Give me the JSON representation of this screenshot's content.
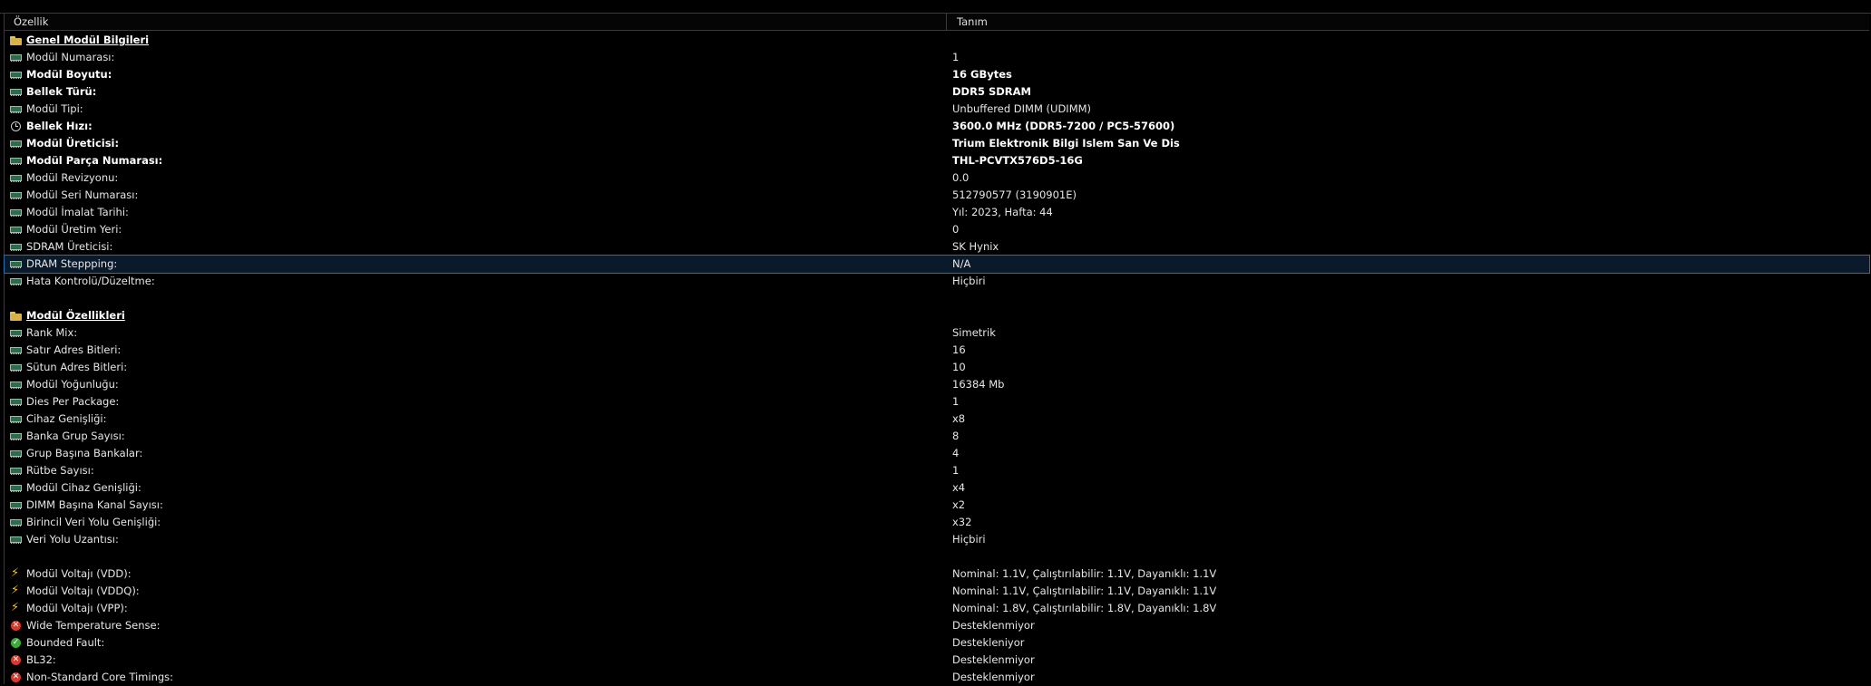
{
  "header": {
    "col_property": "Özellik",
    "col_value": "Tanım"
  },
  "sections": [
    {
      "title": "Genel Modül Bilgileri",
      "rows": [
        {
          "icon": "ram",
          "name": "Modül Numarası:",
          "value": "1",
          "bold": false
        },
        {
          "icon": "ram",
          "name": "Modül Boyutu:",
          "value": "16 GBytes",
          "bold": true
        },
        {
          "icon": "ram",
          "name": "Bellek Türü:",
          "value": "DDR5 SDRAM",
          "bold": true
        },
        {
          "icon": "ram",
          "name": "Modül Tipi:",
          "value": "Unbuffered DIMM (UDIMM)",
          "bold": false
        },
        {
          "icon": "clock",
          "name": "Bellek Hızı:",
          "value": "3600.0 MHz (DDR5-7200 / PC5-57600)",
          "bold": true
        },
        {
          "icon": "ram",
          "name": "Modül Üreticisi:",
          "value": "Trium Elektronik Bilgi Islem San Ve Dis",
          "bold": true
        },
        {
          "icon": "ram",
          "name": "Modül Parça Numarası:",
          "value": "THL-PCVTX576D5-16G",
          "bold": true
        },
        {
          "icon": "ram",
          "name": "Modül Revizyonu:",
          "value": "0.0",
          "bold": false
        },
        {
          "icon": "ram",
          "name": "Modül Seri Numarası:",
          "value": "512790577 (3190901E)",
          "bold": false
        },
        {
          "icon": "ram",
          "name": "Modül İmalat Tarihi:",
          "value": "Yıl: 2023, Hafta: 44",
          "bold": false
        },
        {
          "icon": "ram",
          "name": "Modül Üretim Yeri:",
          "value": "0",
          "bold": false
        },
        {
          "icon": "ram",
          "name": "SDRAM Üreticisi:",
          "value": "SK Hynix",
          "bold": false
        },
        {
          "icon": "ram",
          "name": "DRAM Steppping:",
          "value": "N/A",
          "bold": false,
          "selected": true
        },
        {
          "icon": "ram",
          "name": "Hata Kontrolü/Düzeltme:",
          "value": "Hiçbiri",
          "bold": false
        }
      ]
    },
    {
      "title": "Modül Özellikleri",
      "rows": [
        {
          "icon": "ram",
          "name": "Rank Mix:",
          "value": "Simetrik"
        },
        {
          "icon": "ram",
          "name": "Satır Adres Bitleri:",
          "value": "16"
        },
        {
          "icon": "ram",
          "name": "Sütun Adres Bitleri:",
          "value": "10"
        },
        {
          "icon": "ram",
          "name": "Modül Yoğunluğu:",
          "value": "16384 Mb"
        },
        {
          "icon": "ram",
          "name": "Dies Per Package:",
          "value": "1"
        },
        {
          "icon": "ram",
          "name": "Cihaz Genişliği:",
          "value": "x8"
        },
        {
          "icon": "ram",
          "name": "Banka Grup Sayısı:",
          "value": "8"
        },
        {
          "icon": "ram",
          "name": "Grup Başına Bankalar:",
          "value": "4"
        },
        {
          "icon": "ram",
          "name": "Rütbe Sayısı:",
          "value": "1"
        },
        {
          "icon": "ram",
          "name": "Modül Cihaz Genişliği:",
          "value": "x4"
        },
        {
          "icon": "ram",
          "name": "DIMM Başına Kanal Sayısı:",
          "value": "x2"
        },
        {
          "icon": "ram",
          "name": "Birincil Veri Yolu Genişliği:",
          "value": "x32"
        },
        {
          "icon": "ram",
          "name": "Veri Yolu Uzantısı:",
          "value": "Hiçbiri"
        }
      ]
    },
    {
      "title": "",
      "rows": [
        {
          "icon": "bolt",
          "name": "Modül Voltajı (VDD):",
          "value": "Nominal: 1.1V, Çalıştırılabilir: 1.1V, Dayanıklı: 1.1V"
        },
        {
          "icon": "bolt",
          "name": "Modül Voltajı (VDDQ):",
          "value": "Nominal: 1.1V, Çalıştırılabilir: 1.1V, Dayanıklı: 1.1V"
        },
        {
          "icon": "bolt",
          "name": "Modül Voltajı (VPP):",
          "value": "Nominal: 1.8V, Çalıştırılabilir: 1.8V, Dayanıklı: 1.8V"
        },
        {
          "icon": "x",
          "name": "Wide Temperature Sense:",
          "value": "Desteklenmiyor"
        },
        {
          "icon": "ok",
          "name": "Bounded Fault:",
          "value": "Destekleniyor"
        },
        {
          "icon": "x",
          "name": "BL32:",
          "value": "Desteklenmiyor"
        },
        {
          "icon": "x",
          "name": "Non-Standard Core Timings:",
          "value": "Desteklenmiyor"
        }
      ]
    }
  ]
}
